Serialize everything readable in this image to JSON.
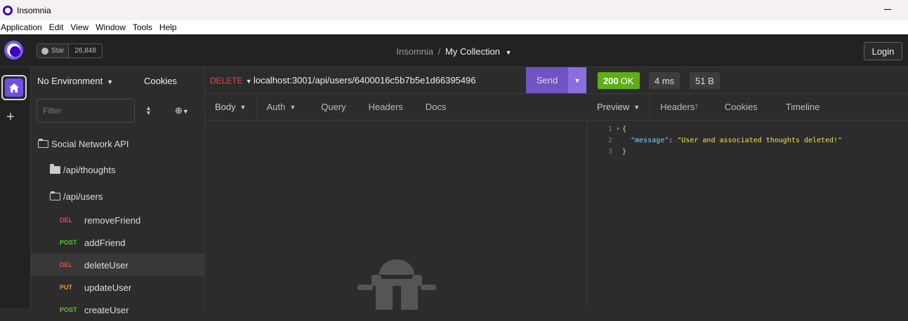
{
  "titlebar": {
    "app_title": "Insomnia"
  },
  "menubar": {
    "items": [
      "Application",
      "Edit",
      "View",
      "Window",
      "Tools",
      "Help"
    ]
  },
  "header": {
    "github_star_label": "Star",
    "github_star_count": "26,848",
    "workspace": "Insomnia",
    "separator": "/",
    "collection": "My Collection",
    "login_label": "Login"
  },
  "sidebar": {
    "environment": "No Environment",
    "cookies_label": "Cookies",
    "filter_placeholder": "Filter",
    "root_folder": "Social Network API",
    "folders": [
      "/api/thoughts",
      "/api/users"
    ],
    "requests": [
      {
        "method": "DEL",
        "name": "removeFriend"
      },
      {
        "method": "POST",
        "name": "addFriend"
      },
      {
        "method": "DEL",
        "name": "deleteUser"
      },
      {
        "method": "PUT",
        "name": "updateUser"
      },
      {
        "method": "POST",
        "name": "createUser"
      }
    ]
  },
  "request": {
    "verb": "DELETE",
    "url": "localhost:3001/api/users/6400016c5b7b5e1d66395496",
    "send_label": "Send",
    "tabs": [
      "Body",
      "Auth",
      "Query",
      "Headers",
      "Docs"
    ]
  },
  "response": {
    "status_code": "200",
    "status_text": "OK",
    "time": "4 ms",
    "size": "51 B",
    "tabs": [
      "Preview",
      "Headers",
      "Cookies",
      "Timeline"
    ],
    "headers_count": "7",
    "body_lines": [
      "1",
      "2",
      "3"
    ],
    "json_open": "{",
    "json_key": "\"message\"",
    "json_colon": ": ",
    "json_value": "\"User and associated thoughts deleted!\"",
    "json_close": "}"
  },
  "colors": {
    "accent": "#7054c3",
    "status_ok": "#5fae17",
    "method_del": "#e5484d",
    "method_post": "#55c236",
    "method_put": "#ef8c34"
  }
}
